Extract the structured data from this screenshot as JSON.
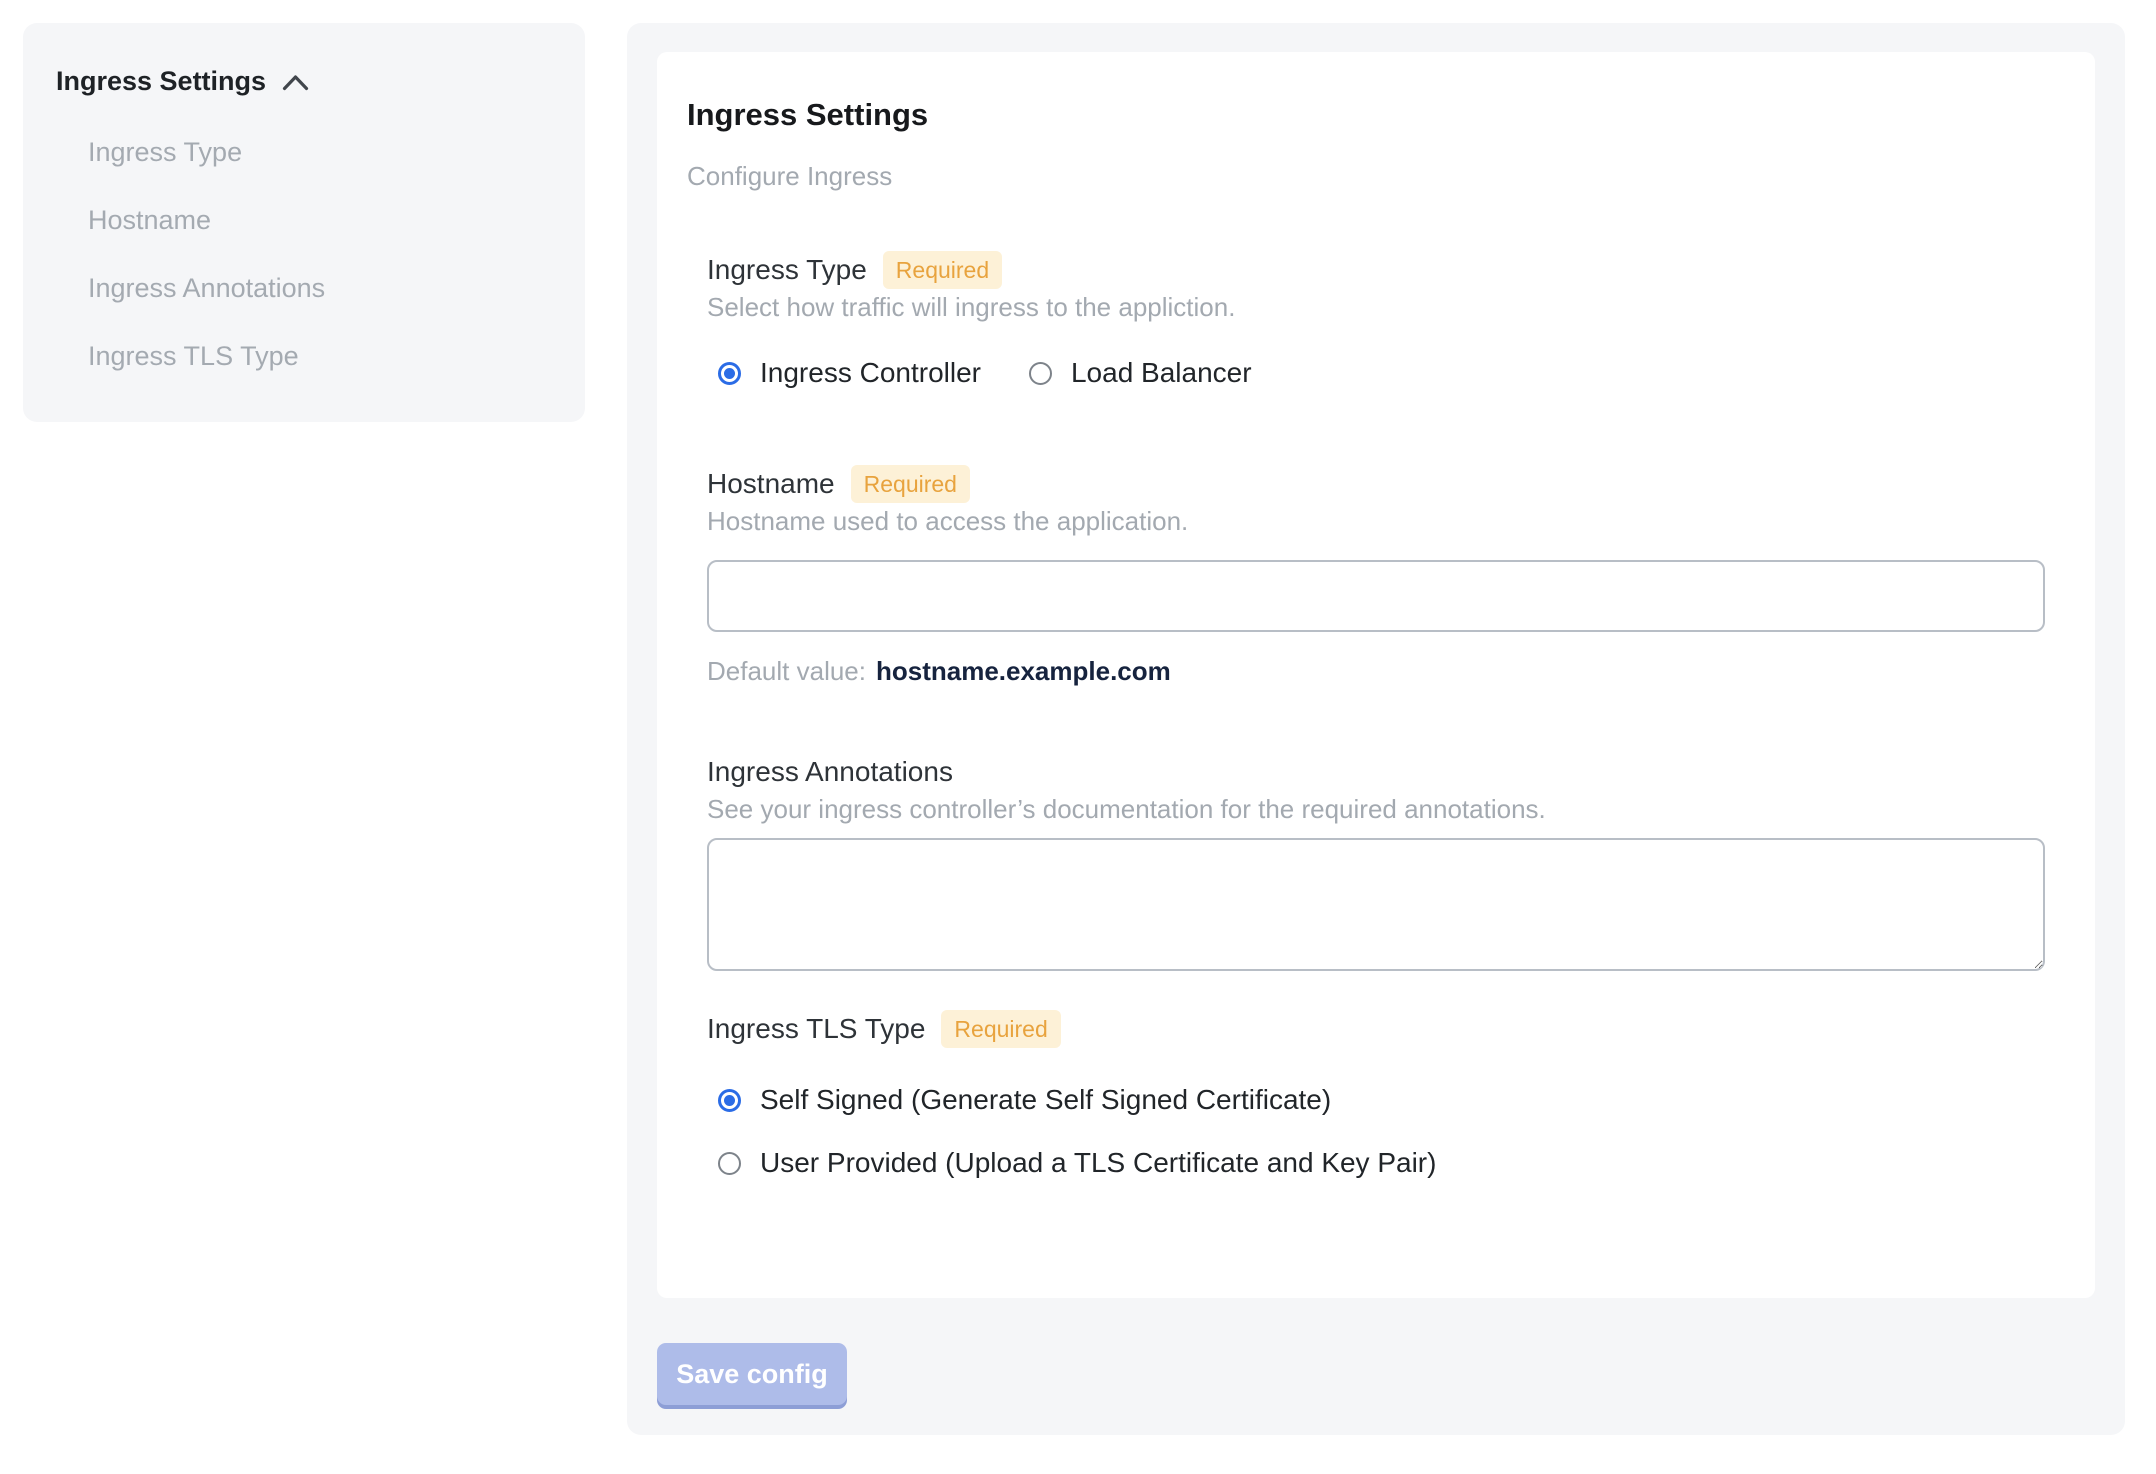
{
  "sidebar": {
    "title": "Ingress Settings",
    "chevron_icon": "chevron-up",
    "items": [
      {
        "label": "Ingress Type"
      },
      {
        "label": "Hostname"
      },
      {
        "label": "Ingress Annotations"
      },
      {
        "label": "Ingress TLS Type"
      }
    ]
  },
  "main": {
    "title": "Ingress Settings",
    "subtitle": "Configure Ingress",
    "required_badge": "Required",
    "sections": {
      "ingress_type": {
        "label": "Ingress Type",
        "required": true,
        "description": "Select how traffic will ingress to the appliction.",
        "options": [
          {
            "label": "Ingress Controller",
            "selected": true
          },
          {
            "label": "Load Balancer",
            "selected": false
          }
        ]
      },
      "hostname": {
        "label": "Hostname",
        "required": true,
        "description": "Hostname used to access the application.",
        "value": "",
        "default_label": "Default value:",
        "default_value": "hostname.example.com"
      },
      "annotations": {
        "label": "Ingress Annotations",
        "description": "See your ingress controller’s documentation for the required annotations.",
        "value": ""
      },
      "tls_type": {
        "label": "Ingress TLS Type",
        "required": true,
        "options": [
          {
            "label": "Self Signed (Generate Self Signed Certificate)",
            "selected": true
          },
          {
            "label": "User Provided (Upload a TLS Certificate and Key Pair)",
            "selected": false
          }
        ]
      }
    },
    "save_button": "Save config"
  },
  "colors": {
    "panel_bg": "#f5f6f8",
    "card_bg": "#ffffff",
    "accent_blue": "#2b6ce6",
    "badge_bg": "#fdf1d7",
    "badge_text": "#e8a33e",
    "button_bg": "#aebce9",
    "button_shadow": "#8d9ed6",
    "muted_text": "#a3a9b0",
    "default_value_text": "#16233e"
  }
}
